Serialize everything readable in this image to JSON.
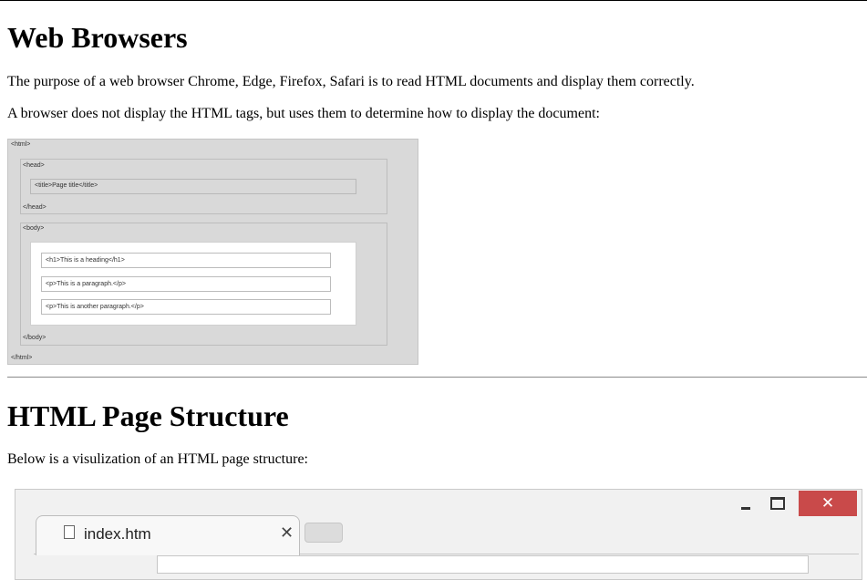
{
  "section_browsers": {
    "heading": "Web Browsers",
    "para_purpose": "The purpose of a web browser Chrome, Edge, Firefox, Safari is to read HTML documents and display them correctly.",
    "para_tags": "A browser does not display the HTML tags, but uses them to determine how to display the document:"
  },
  "diagram": {
    "html_open": "<html>",
    "head_open": "<head>",
    "title": "<title>Page title</title>",
    "head_close": "</head>",
    "body_open": "<body>",
    "h1": "<h1>This is a heading</h1>",
    "p1": "<p>This is a paragraph.</p>",
    "p2": "<p>This is another paragraph.</p>",
    "body_close": "</body>",
    "html_close": "</html>"
  },
  "section_structure": {
    "heading": "HTML Page Structure",
    "para_below": "Below is a visulization of an HTML page structure:"
  },
  "browser_mock": {
    "tab_label": "index.htm",
    "tab_close_glyph": "✕",
    "close_glyph": "✕",
    "icons": [
      "file-icon",
      "minimize-icon",
      "maximize-icon",
      "close-icon"
    ]
  }
}
